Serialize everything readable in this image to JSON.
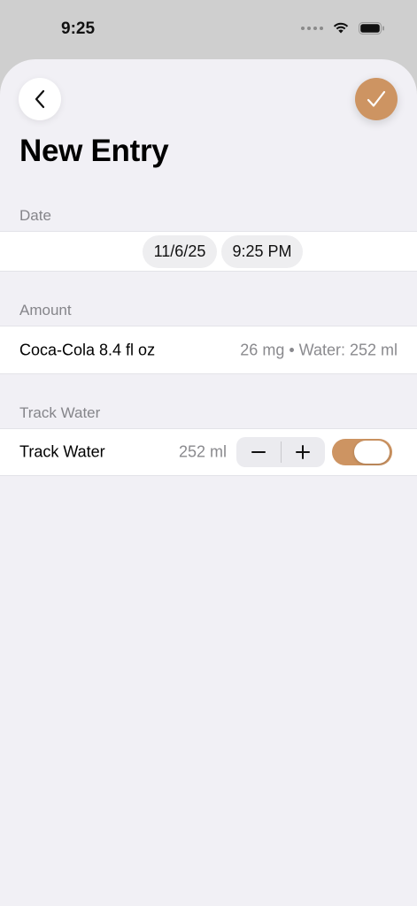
{
  "status_bar": {
    "time": "9:25"
  },
  "header": {
    "title": "New Entry"
  },
  "date_section": {
    "header": "Date",
    "date": "11/6/25",
    "time": "9:25 PM"
  },
  "amount_section": {
    "header": "Amount",
    "drink": "Coca-Cola 8.4 fl oz",
    "detail": "26 mg • Water: 252 ml"
  },
  "water_section": {
    "header": "Track Water",
    "label": "Track Water",
    "value": "252 ml",
    "toggle_on": true
  },
  "colors": {
    "accent": "#cd9462",
    "background": "#f1f0f5",
    "secondary_text": "#8a8a8e"
  }
}
